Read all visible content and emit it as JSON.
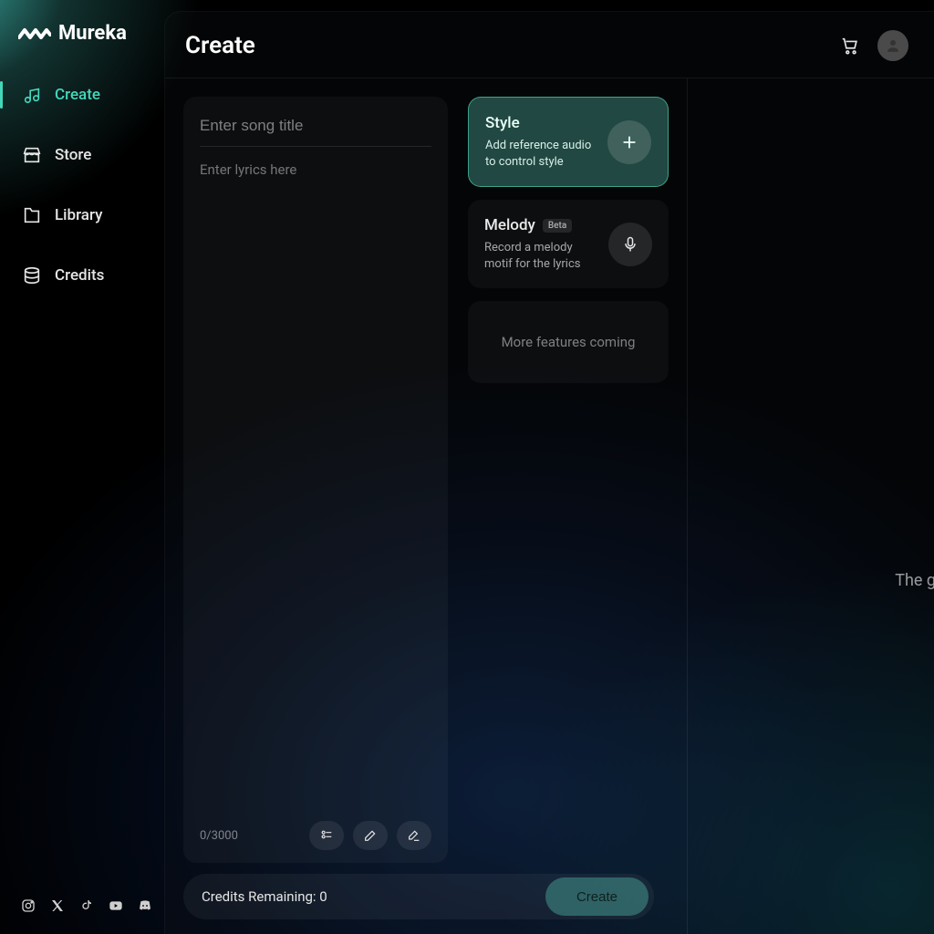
{
  "brand": "Mureka",
  "sidebar": {
    "items": [
      {
        "label": "Create",
        "icon": "music-icon",
        "active": true
      },
      {
        "label": "Store",
        "icon": "store-icon",
        "active": false
      },
      {
        "label": "Library",
        "icon": "library-icon",
        "active": false
      },
      {
        "label": "Credits",
        "icon": "credits-icon",
        "active": false
      }
    ],
    "socials": [
      "instagram",
      "x-twitter",
      "tiktok",
      "youtube",
      "discord"
    ]
  },
  "header": {
    "title": "Create"
  },
  "lyrics": {
    "title_placeholder": "Enter song title",
    "title_value": "",
    "body_placeholder": "Enter lyrics here",
    "body_value": "",
    "char_count": "0/3000"
  },
  "cards": {
    "style": {
      "title": "Style",
      "desc": "Add reference audio to control style"
    },
    "melody": {
      "title": "Melody",
      "badge": "Beta",
      "desc": "Record a melody motif for the lyrics"
    },
    "more": "More features coming"
  },
  "footer": {
    "credits_label": "Credits Remaining: 0",
    "create_label": "Create"
  },
  "right_col": {
    "message": "The g"
  },
  "colors": {
    "accent": "#44d8bb"
  }
}
